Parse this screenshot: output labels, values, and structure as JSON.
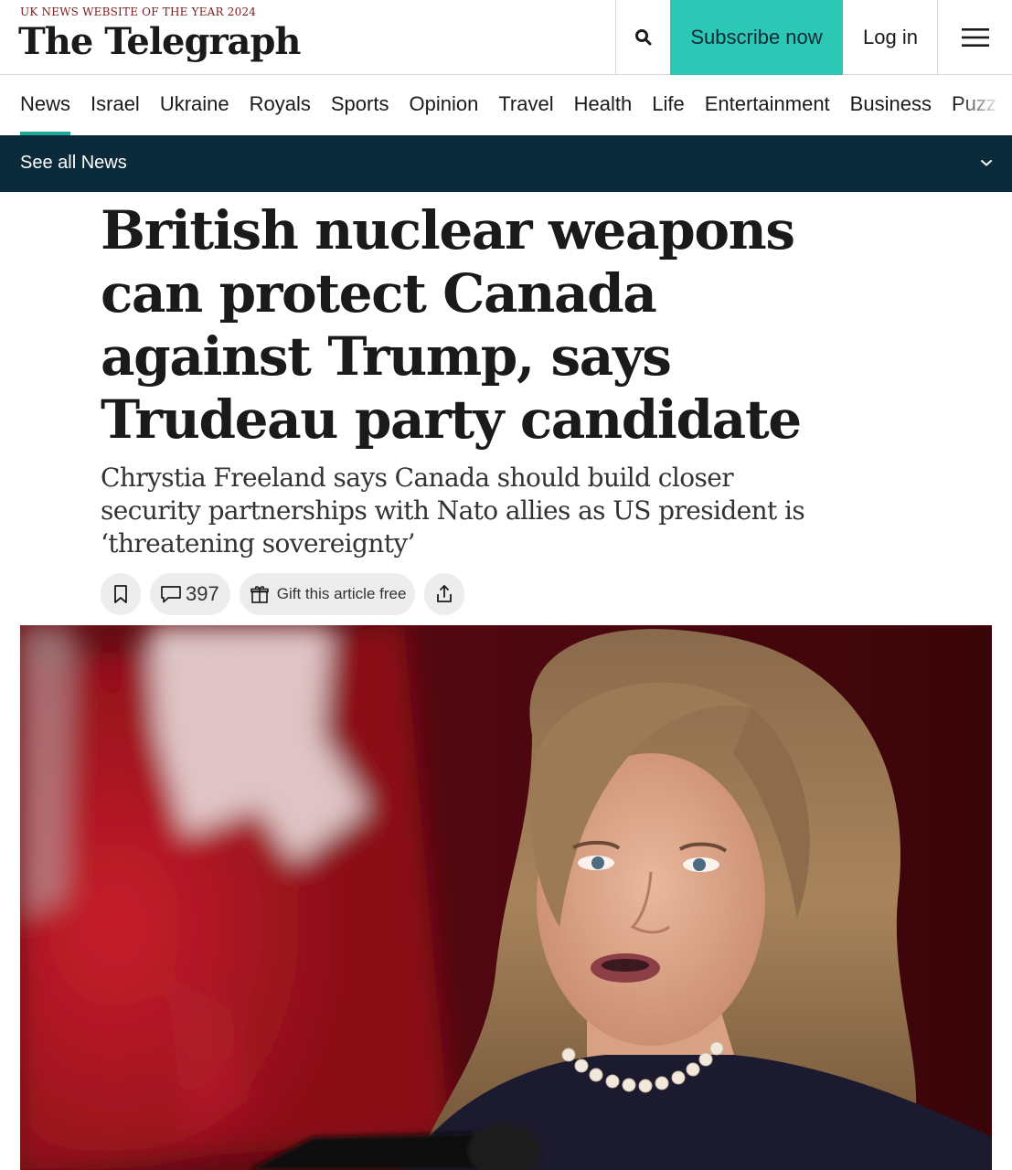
{
  "masthead": {
    "award": "UK NEWS WEBSITE OF THE YEAR 2024",
    "logo": "The Telegraph",
    "subscribe_label": "Subscribe now",
    "login_label": "Log in",
    "accent_color": "#2dc7b5",
    "icons": {
      "search": "search-icon",
      "menu": "hamburger-menu-icon"
    }
  },
  "nav": {
    "items": [
      {
        "label": "News"
      },
      {
        "label": "Israel"
      },
      {
        "label": "Ukraine"
      },
      {
        "label": "Royals"
      },
      {
        "label": "Sports"
      },
      {
        "label": "Opinion"
      },
      {
        "label": "Travel"
      },
      {
        "label": "Health"
      },
      {
        "label": "Life"
      },
      {
        "label": "Entertainment"
      },
      {
        "label": "Business"
      },
      {
        "label": "Puzz"
      }
    ],
    "active": "News"
  },
  "see_all": {
    "label": "See all News",
    "background": "#0b2a3a"
  },
  "article": {
    "headline": "British nuclear weapons can protect Canada against Trump, says Trudeau party candidate",
    "standfirst": "Chrystia Freeland says Canada should build closer security partnerships with Nato allies as US president is ‘threatening sovereignty’",
    "comment_count": "397",
    "gift_label": "Gift this article free",
    "action_icons": [
      "bookmark-icon",
      "comment-icon",
      "gift-icon",
      "share-icon"
    ]
  }
}
